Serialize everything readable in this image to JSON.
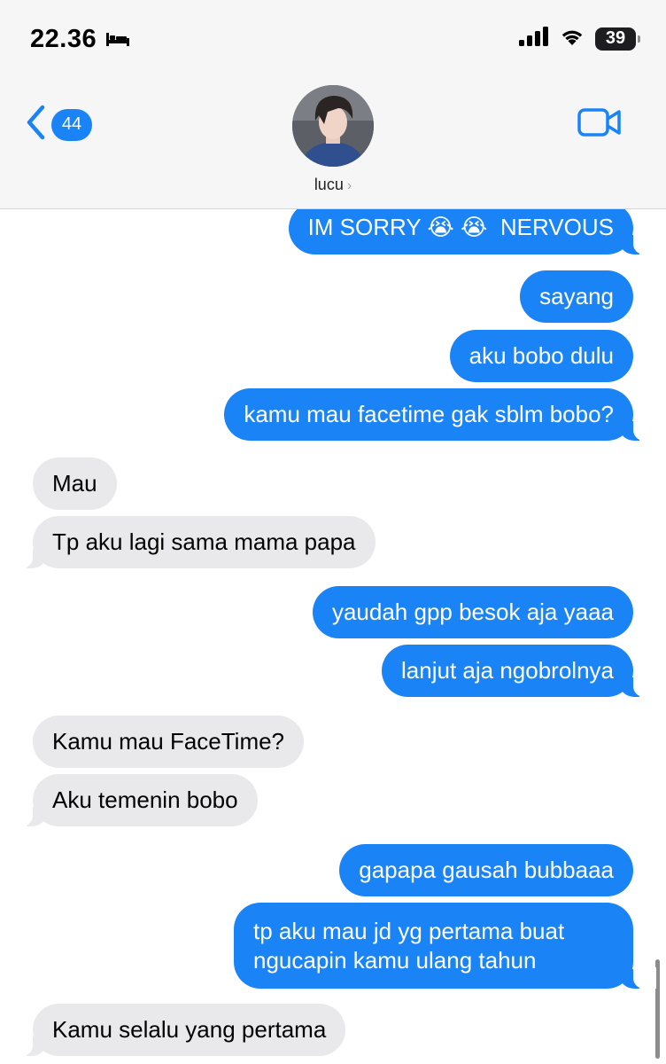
{
  "status_bar": {
    "time": "22.36",
    "battery": "39"
  },
  "nav": {
    "back_count": "44",
    "contact_name": "lucu",
    "icons": [
      "chevron-left-icon",
      "video-camera-icon",
      "bed-icon",
      "signal-icon",
      "wifi-icon",
      "battery-icon"
    ],
    "colors": {
      "accent": "#1a84f7",
      "received_bubble": "#e9e9eb"
    }
  },
  "messages": [
    {
      "dir": "sent",
      "text": "IM SORRY 😭😭 NERVOUS",
      "parts": [
        "IM SORRY ",
        "😭",
        " ",
        "😭",
        "  NERVOUS"
      ]
    },
    {
      "dir": "sent",
      "text": "sayang"
    },
    {
      "dir": "sent",
      "text": "aku bobo dulu"
    },
    {
      "dir": "sent",
      "text": "kamu mau facetime gak sblm bobo?"
    },
    {
      "dir": "received",
      "text": "Mau"
    },
    {
      "dir": "received",
      "text": "Tp aku lagi sama mama papa"
    },
    {
      "dir": "sent",
      "text": "yaudah gpp besok aja yaaa"
    },
    {
      "dir": "sent",
      "text": "lanjut aja ngobrolnya"
    },
    {
      "dir": "received",
      "text": "Kamu mau FaceTime?"
    },
    {
      "dir": "received",
      "text": "Aku temenin bobo"
    },
    {
      "dir": "sent",
      "text": "gapapa gausah bubbaaa"
    },
    {
      "dir": "sent",
      "text": "tp aku mau jd yg pertama buat ngucapin kamu ulang tahun"
    },
    {
      "dir": "received",
      "text": "Kamu selalu yang pertama"
    }
  ]
}
